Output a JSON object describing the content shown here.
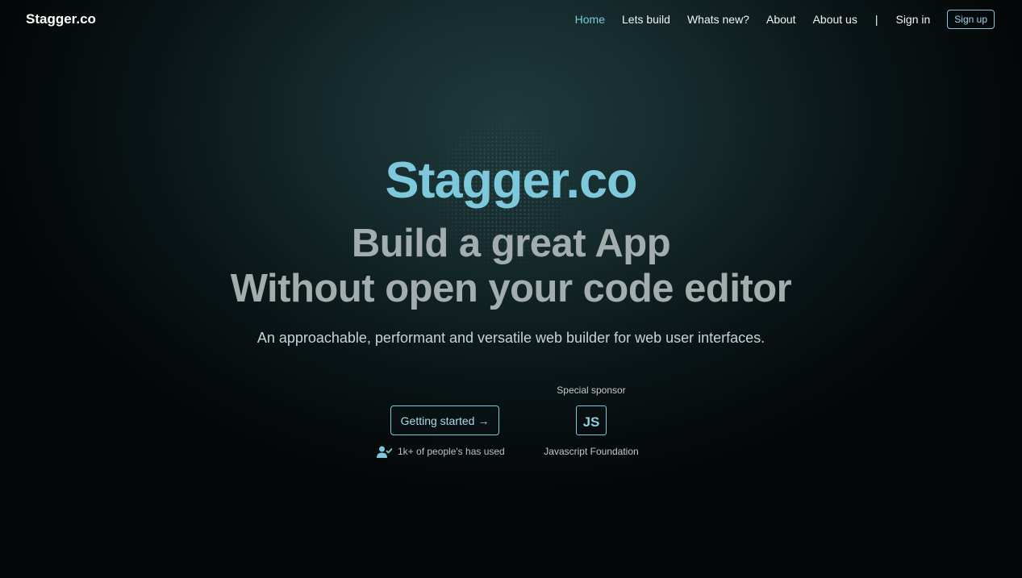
{
  "header": {
    "brand": "Stagger.co",
    "nav": [
      {
        "label": "Home",
        "active": true
      },
      {
        "label": "Lets build"
      },
      {
        "label": "Whats new?"
      },
      {
        "label": "About"
      },
      {
        "label": "About us"
      }
    ],
    "separator": "|",
    "sign_in": "Sign in",
    "sign_up": "Sign up"
  },
  "hero": {
    "brand": "Stagger.co",
    "line1": "Build a great App",
    "line2": "Without open your code editor",
    "subtitle": "An approachable, performant and versatile web builder for web user interfaces."
  },
  "cta": {
    "label": "Getting started →",
    "users_text": "1k+ of people's has used",
    "users_icon": "user-check-icon"
  },
  "sponsor": {
    "label": "Special sponsor",
    "logo_text": "JS",
    "name": "Javascript Foundation"
  },
  "colors": {
    "accent": "#7ec8dc",
    "headline": "#a4adae",
    "background": "#0a1416"
  }
}
